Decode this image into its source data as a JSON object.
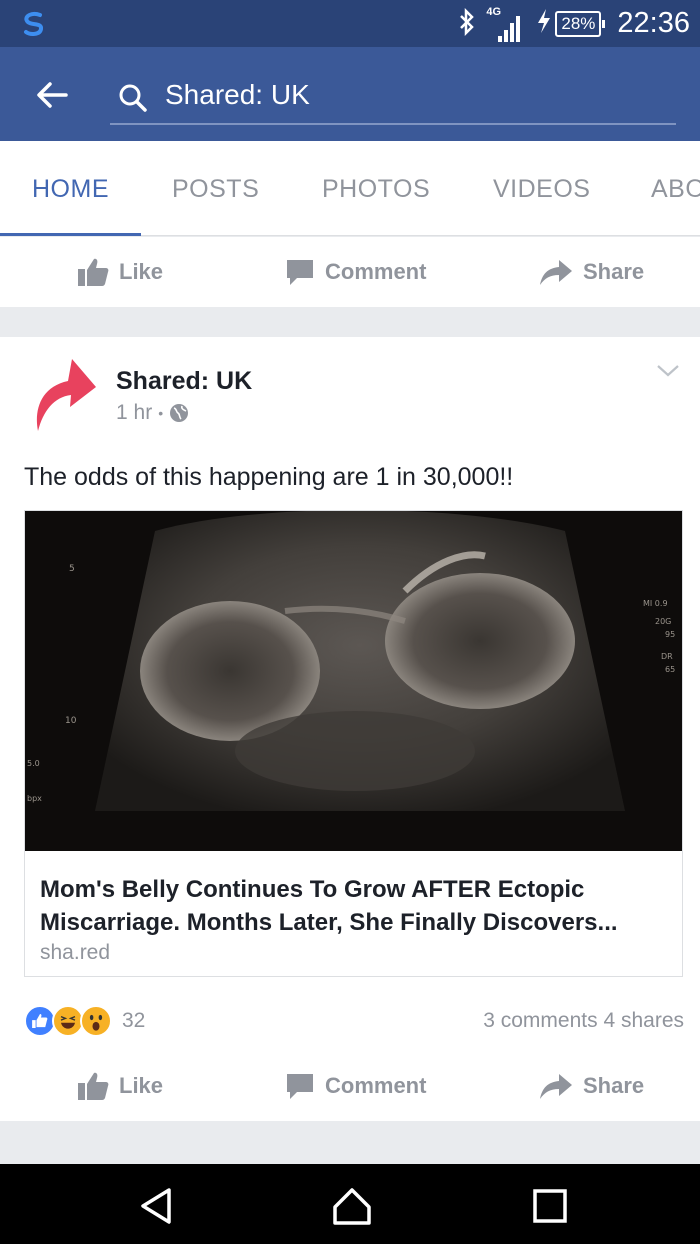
{
  "status_bar": {
    "network": "4G",
    "battery": "28%",
    "time": "22:36"
  },
  "header": {
    "search_text": "Shared: UK"
  },
  "tabs": [
    {
      "label": "HOME",
      "active": true
    },
    {
      "label": "POSTS",
      "active": false
    },
    {
      "label": "PHOTOS",
      "active": false
    },
    {
      "label": "VIDEOS",
      "active": false
    },
    {
      "label": "ABO",
      "active": false
    }
  ],
  "top_actions": {
    "like": "Like",
    "comment": "Comment",
    "share": "Share"
  },
  "post": {
    "page_name": "Shared: UK",
    "time": "1 hr",
    "separator": "•",
    "text": "The odds of this happening are 1 in 30,000!!",
    "link": {
      "title": "Mom's Belly Continues To Grow AFTER Ectopic Miscarriage. Months Later, She Finally Discovers...",
      "domain": "sha.red",
      "image_overlay": {
        "depth_1": "5",
        "depth_2": "10",
        "left_label_1": "5.0",
        "left_label_2": "bpx",
        "right_1": "MI 0.9",
        "right_2": "20G",
        "right_3": "95",
        "right_4": "DR",
        "right_5": "65"
      }
    },
    "reactions": [
      "like",
      "haha",
      "wow"
    ],
    "reaction_count": "32",
    "comments": "3 comments",
    "shares": "4 shares",
    "actions": {
      "like": "Like",
      "comment": "Comment",
      "share": "Share"
    }
  },
  "colors": {
    "status_bar": "#2a4377",
    "header": "#3b5998",
    "accent": "#4267b2",
    "muted": "#90949c",
    "share_logo": "#e8425e"
  }
}
